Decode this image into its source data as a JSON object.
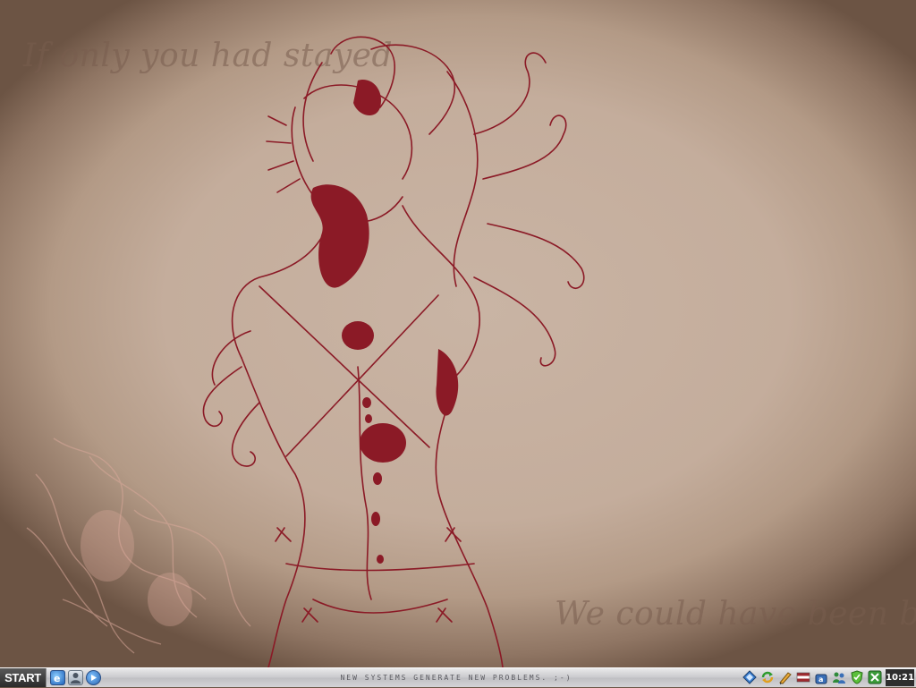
{
  "wallpaper": {
    "text_top": "If only you had stayed",
    "text_bottom": "We could have been beautiful",
    "ink_color": "#8b1a26",
    "background_color": "#c4ad9c"
  },
  "taskbar": {
    "start_label": "START",
    "ticker_text": "NEW SYSTEMS GENERATE NEW PROBLEMS. ;-)",
    "quick_launch": [
      {
        "icon": "internet-explorer-icon"
      },
      {
        "icon": "user-icon"
      },
      {
        "icon": "media-player-icon"
      }
    ],
    "tray_icons": [
      "network-diamond-icon",
      "refresh-arrows-icon",
      "pen-tool-icon",
      "flag-icon",
      "bag-icon",
      "people-icon",
      "security-shield-icon",
      "green-x-icon"
    ],
    "clock": "10:21"
  }
}
